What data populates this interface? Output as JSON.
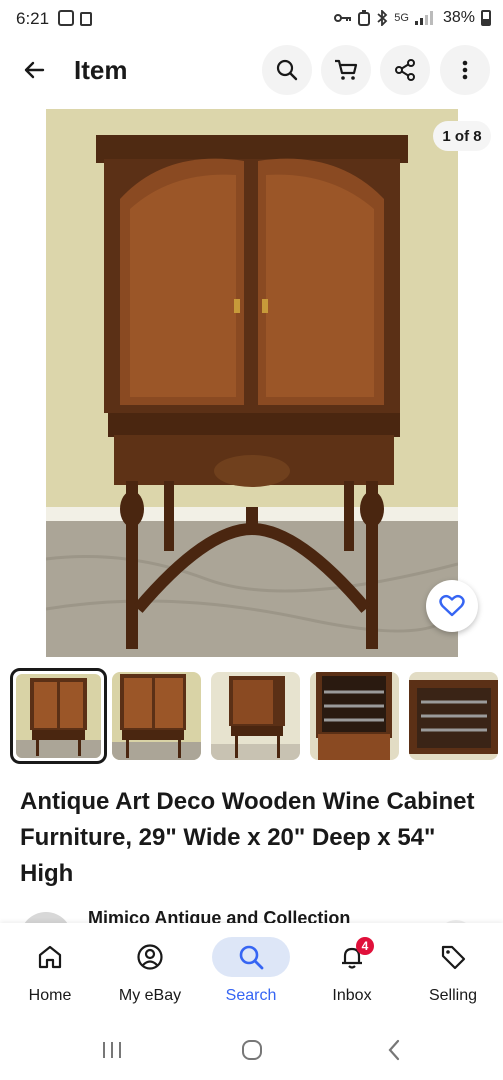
{
  "status_bar": {
    "time": "6:21",
    "network": "5G",
    "battery": "38%"
  },
  "header": {
    "title": "Item"
  },
  "gallery": {
    "counter": "1 of 8",
    "thumbnail_count": 5,
    "selected_index": 0
  },
  "item": {
    "title": "Antique Art Deco Wooden Wine Cabinet Furniture, 29\" Wide x 20\" Deep x 54\" High"
  },
  "seller": {
    "name": "Mimico Antique and Collection"
  },
  "bottom_nav": {
    "items": [
      {
        "label": "Home",
        "icon": "home-icon"
      },
      {
        "label": "My eBay",
        "icon": "profile-icon"
      },
      {
        "label": "Search",
        "icon": "search-icon"
      },
      {
        "label": "Inbox",
        "icon": "bell-icon",
        "badge": "4"
      },
      {
        "label": "Selling",
        "icon": "tag-icon"
      }
    ],
    "active": "Search"
  },
  "colors": {
    "accent": "#3665f3",
    "accent_pill": "#dde6f7",
    "badge": "#e0103a",
    "text": "#191919",
    "wood": "#6b3b1c"
  }
}
